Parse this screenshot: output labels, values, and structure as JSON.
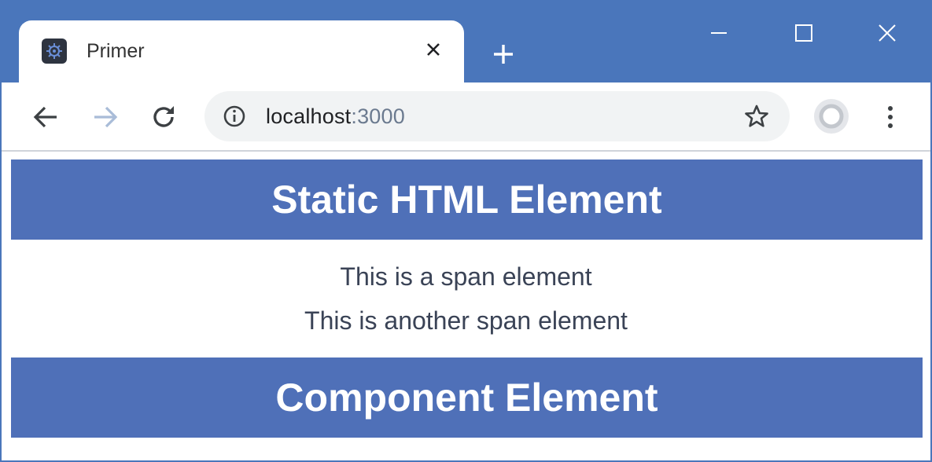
{
  "browser": {
    "tab": {
      "title": "Primer",
      "favicon": "angular-gear-icon"
    },
    "new_tab_symbol": "+",
    "window_controls": [
      "minimize-icon",
      "maximize-icon",
      "close-icon"
    ],
    "toolbar": {
      "back": "back-arrow-icon",
      "forward": "forward-arrow-icon",
      "reload": "reload-icon",
      "url_host": "localhost",
      "url_port": ":3000",
      "bookmark": "star-icon",
      "profile": "profile-avatar-icon",
      "menu": "kebab-menu-icon"
    }
  },
  "page": {
    "heading_static": "Static HTML Element",
    "span_1": "This is a span element",
    "span_2": "This is another span element",
    "heading_component": "Component Element"
  },
  "colors": {
    "titlebar": "#4a76bb",
    "banner": "#4f70b8",
    "span_text": "#3a4356"
  }
}
